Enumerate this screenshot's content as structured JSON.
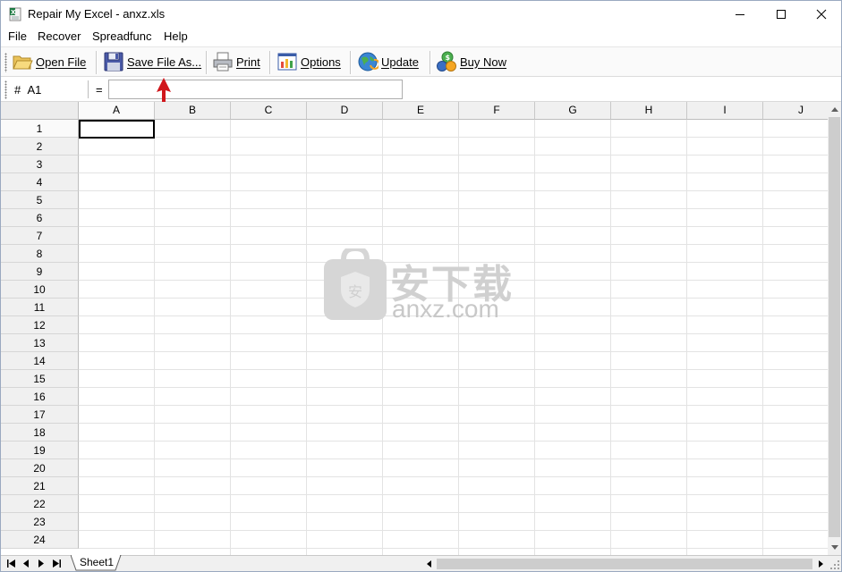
{
  "window": {
    "title": "Repair My Excel - anxz.xls",
    "controls": [
      "minimize-icon",
      "maximize-icon",
      "close-icon"
    ]
  },
  "menu": {
    "items": [
      "File",
      "Recover",
      "Spreadfunc",
      "Help"
    ]
  },
  "toolbar": {
    "buttons": [
      {
        "label": "Open File",
        "icon": "folder-open-icon"
      },
      {
        "label": "Save File As...",
        "icon": "floppy-disk-icon"
      },
      {
        "label": "Print",
        "icon": "printer-icon"
      },
      {
        "label": "Options",
        "icon": "options-chart-icon"
      },
      {
        "label": "Update",
        "icon": "globe-update-icon"
      },
      {
        "label": "Buy Now",
        "icon": "coins-icon"
      }
    ]
  },
  "formula_bar": {
    "hash": "#",
    "cell_ref": "A1",
    "equals": "=",
    "value": ""
  },
  "grid": {
    "columns": [
      "A",
      "B",
      "C",
      "D",
      "E",
      "F",
      "G",
      "H",
      "I",
      "J"
    ],
    "rows": [
      "1",
      "2",
      "3",
      "4",
      "5",
      "6",
      "7",
      "8",
      "9",
      "10",
      "11",
      "12",
      "13",
      "14",
      "15",
      "16",
      "17",
      "18",
      "19",
      "20",
      "21",
      "22",
      "23",
      "24"
    ],
    "active_cell": "A1"
  },
  "watermark": {
    "cn": "安下载",
    "en": "anxz.com"
  },
  "sheets": {
    "tabs": [
      "Sheet1"
    ],
    "active": "Sheet1"
  },
  "colors": {
    "annotation_arrow": "#d0161b",
    "grid_line": "#e3e3e3",
    "header_bg": "#f0f0f0"
  }
}
